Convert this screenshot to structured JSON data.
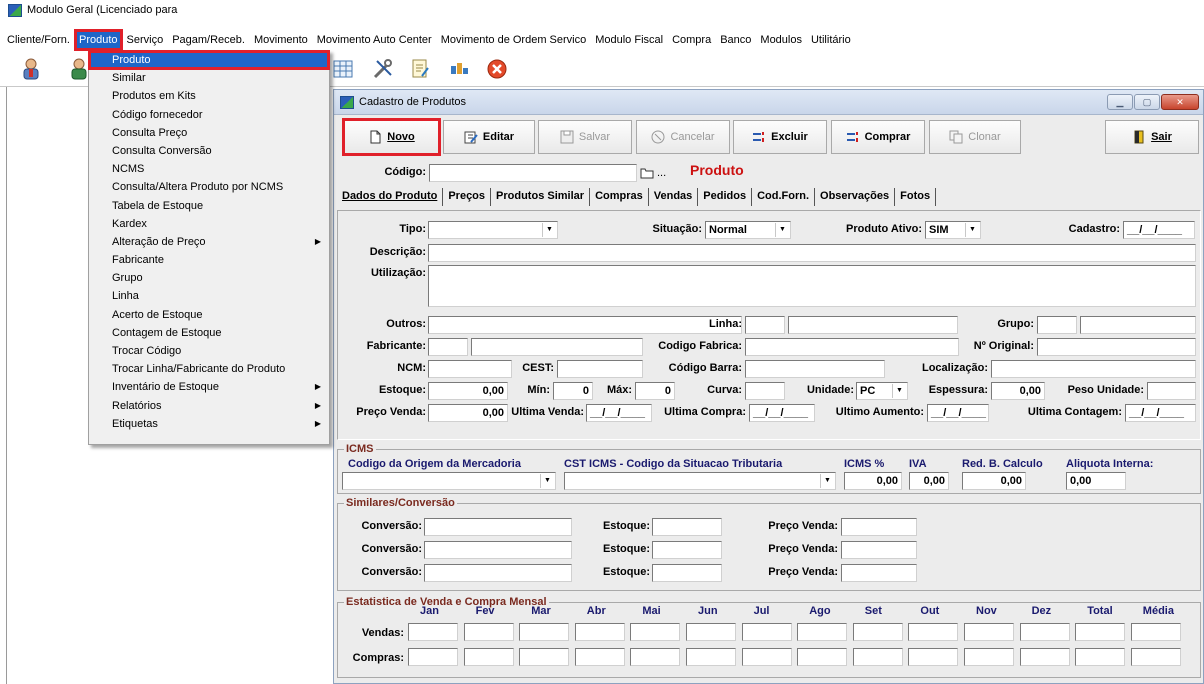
{
  "app": {
    "title": "Modulo Geral (Licenciado para"
  },
  "menubar": [
    "Cliente/Forn.",
    "Produto",
    "Serviço",
    "Pagam/Receb.",
    "Movimento",
    "Movimento Auto Center",
    "Movimento de Ordem Servico",
    "Modulo Fiscal",
    "Compra",
    "Banco",
    "Modulos",
    "Utilitário"
  ],
  "dropdown": {
    "items": [
      {
        "label": "Produto",
        "submenu": false
      },
      {
        "label": "Similar",
        "submenu": false
      },
      {
        "label": "Produtos em Kits",
        "submenu": false
      },
      {
        "label": "Código fornecedor",
        "submenu": false
      },
      {
        "label": "Consulta Preço",
        "submenu": false
      },
      {
        "label": "Consulta Conversão",
        "submenu": false
      },
      {
        "label": "NCMS",
        "submenu": false
      },
      {
        "label": "Consulta/Altera Produto por NCMS",
        "submenu": false
      },
      {
        "label": "Tabela de Estoque",
        "submenu": false
      },
      {
        "label": "Kardex",
        "submenu": false
      },
      {
        "label": "Alteração de Preço",
        "submenu": true
      },
      {
        "label": "Fabricante",
        "submenu": false
      },
      {
        "label": "Grupo",
        "submenu": false
      },
      {
        "label": "Linha",
        "submenu": false
      },
      {
        "label": "Acerto de Estoque",
        "submenu": false
      },
      {
        "label": "Contagem de Estoque",
        "submenu": false
      },
      {
        "label": "Trocar Código",
        "submenu": false
      },
      {
        "label": "Trocar Linha/Fabricante do Produto",
        "submenu": false
      },
      {
        "label": "Inventário de Estoque",
        "submenu": true
      },
      {
        "label": "Relatórios",
        "submenu": true
      },
      {
        "label": "Etiquetas",
        "submenu": true
      }
    ]
  },
  "window": {
    "title": "Cadastro de Produtos",
    "buttons": {
      "novo": "Novo",
      "editar": "Editar",
      "salvar": "Salvar",
      "cancelar": "Cancelar",
      "excluir": "Excluir",
      "comprar": "Comprar",
      "clonar": "Clonar",
      "sair": "Sair"
    },
    "codigo_label": "Código:",
    "codigo_value": "",
    "browse_label": "...",
    "produto_caption": "Produto",
    "tabs": [
      "Dados do Produto",
      "Preços",
      "Produtos Similar",
      "Compras",
      "Vendas",
      "Pedidos",
      "Cod.Forn.",
      "Observações",
      "Fotos"
    ],
    "form": {
      "tipo": "Tipo:",
      "tipo_value": "",
      "situacao": "Situação:",
      "situacao_value": "Normal",
      "produto_ativo": "Produto Ativo:",
      "produto_ativo_value": "SIM",
      "cadastro": "Cadastro:",
      "cadastro_value": "__/__/____",
      "descricao": "Descrição:",
      "utilizacao": "Utilização:",
      "outros": "Outros:",
      "linha": "Linha:",
      "grupo": "Grupo:",
      "fabricante": "Fabricante:",
      "codigo_fabrica": "Codigo Fabrica:",
      "n_original": "Nº Original:",
      "ncm": "NCM:",
      "cest": "CEST:",
      "codigo_barra": "Código Barra:",
      "localizacao": "Localização:",
      "estoque": "Estoque:",
      "estoque_value": "0,00",
      "min": "Mín:",
      "min_value": "0",
      "max": "Máx:",
      "max_value": "0",
      "curva": "Curva:",
      "unidade": "Unidade:",
      "unidade_value": "PC",
      "espessura": "Espessura:",
      "espessura_value": "0,00",
      "peso_unidade": "Peso Unidade:",
      "preco_venda": "Preço Venda:",
      "preco_venda_value": "0,00",
      "ultima_venda": "Ultima Venda:",
      "ultima_venda_value": "__/__/____",
      "ultima_compra": "Ultima Compra:",
      "ultima_compra_value": "__/__/____",
      "ultimo_aumento": "Ultimo Aumento:",
      "ultimo_aumento_value": "__/__/____",
      "ultima_contagem": "Ultima Contagem:",
      "ultima_contagem_value": "__/__/____"
    },
    "icms": {
      "title": "ICMS",
      "origem": "Codigo da Origem da Mercadoria",
      "cst": "CST ICMS - Codigo da Situacao Tributaria",
      "icms_pct": "ICMS %",
      "icms_pct_value": "0,00",
      "iva": "IVA",
      "iva_value": "0,00",
      "red_b": "Red. B. Calculo",
      "red_b_value": "0,00",
      "aliquota": "Aliquota Interna:",
      "aliquota_value": "0,00"
    },
    "similares": {
      "title": "Similares/Conversão",
      "conversao": "Conversão:",
      "estoque": "Estoque:",
      "preco_venda": "Preço Venda:"
    },
    "estatistica": {
      "title": "Estatistica de Venda e Compra Mensal",
      "months": [
        "Jan",
        "Fev",
        "Mar",
        "Abr",
        "Mai",
        "Jun",
        "Jul",
        "Ago",
        "Set",
        "Out",
        "Nov",
        "Dez",
        "Total",
        "Média"
      ],
      "vendas": "Vendas:",
      "compras": "Compras:"
    }
  },
  "colors": {
    "highlight_red": "#e0202a",
    "menu_selected_blue": "#1e66c8",
    "produto_caption": "#cc1111"
  }
}
